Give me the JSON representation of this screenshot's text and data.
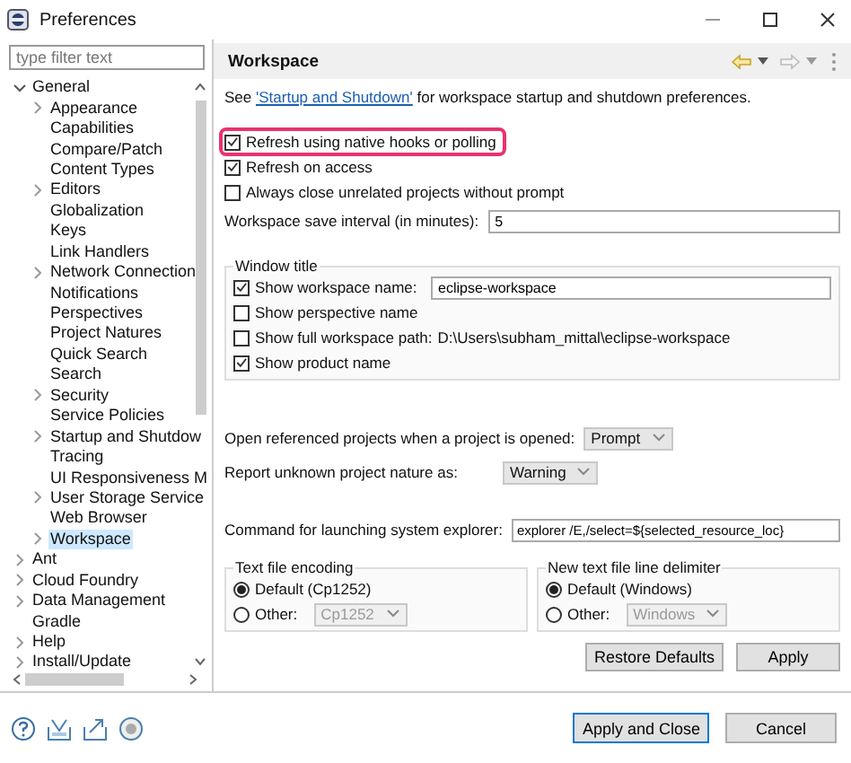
{
  "window": {
    "title": "Preferences"
  },
  "filter": {
    "placeholder": "type filter text"
  },
  "tree": [
    {
      "label": "General",
      "expanded": true,
      "selected": false,
      "children": [
        {
          "label": "Appearance",
          "expanded": false,
          "selected": false
        },
        {
          "label": "Capabilities",
          "selected": false
        },
        {
          "label": "Compare/Patch",
          "selected": false
        },
        {
          "label": "Content Types",
          "selected": false
        },
        {
          "label": "Editors",
          "expanded": false,
          "selected": false
        },
        {
          "label": "Globalization",
          "selected": false
        },
        {
          "label": "Keys",
          "selected": false
        },
        {
          "label": "Link Handlers",
          "selected": false
        },
        {
          "label": "Network Connection",
          "expanded": false,
          "selected": false
        },
        {
          "label": "Notifications",
          "selected": false
        },
        {
          "label": "Perspectives",
          "selected": false
        },
        {
          "label": "Project Natures",
          "selected": false
        },
        {
          "label": "Quick Search",
          "selected": false
        },
        {
          "label": "Search",
          "selected": false
        },
        {
          "label": "Security",
          "expanded": false,
          "selected": false
        },
        {
          "label": "Service Policies",
          "selected": false
        },
        {
          "label": "Startup and Shutdow",
          "expanded": false,
          "selected": false
        },
        {
          "label": "Tracing",
          "selected": false
        },
        {
          "label": "UI Responsiveness M",
          "selected": false
        },
        {
          "label": "User Storage Service",
          "expanded": false,
          "selected": false
        },
        {
          "label": "Web Browser",
          "selected": false
        },
        {
          "label": "Workspace",
          "expanded": false,
          "selected": true
        }
      ]
    },
    {
      "label": "Ant",
      "expanded": false,
      "selected": false
    },
    {
      "label": "Cloud Foundry",
      "expanded": false,
      "selected": false
    },
    {
      "label": "Data Management",
      "expanded": false,
      "selected": false
    },
    {
      "label": "Gradle",
      "selected": false
    },
    {
      "label": "Help",
      "expanded": false,
      "selected": false
    },
    {
      "label": "Install/Update",
      "expanded": false,
      "selected": false
    }
  ],
  "page": {
    "title": "Workspace",
    "intro": {
      "before": "See ",
      "link": "'Startup and Shutdown'",
      "after": " for workspace startup and shutdown preferences."
    },
    "checkboxes": [
      {
        "label": "Refresh using native hooks or polling",
        "checked": true,
        "highlighted": true
      },
      {
        "label": "Refresh on access",
        "checked": true,
        "highlighted": false
      },
      {
        "label": "Always close unrelated projects without prompt",
        "checked": false,
        "highlighted": false
      }
    ],
    "save_interval": {
      "label": "Workspace save interval (in minutes):",
      "value": "5"
    },
    "window_title": {
      "title": "Window title",
      "rows": [
        {
          "kind": "field",
          "label": "Show workspace name:",
          "checked": true,
          "value": "eclipse-workspace"
        },
        {
          "kind": "plain",
          "label": "Show perspective name",
          "checked": false
        },
        {
          "kind": "info",
          "label": "Show full workspace path:",
          "checked": false,
          "value": "D:\\Users\\subham_mittal\\eclipse-workspace"
        },
        {
          "kind": "plain",
          "label": "Show product name",
          "checked": true
        }
      ]
    },
    "selects": [
      {
        "label": "Open referenced projects when a project is opened:",
        "value": "Prompt"
      },
      {
        "label": "Report unknown project nature as:",
        "value": "Warning"
      }
    ],
    "explorer": {
      "label": "Command for launching system explorer:",
      "value": "explorer /E,/select=${selected_resource_loc}"
    },
    "groups": [
      {
        "title": "Text file encoding",
        "options": [
          {
            "label": "Default (Cp1252)",
            "selected": true
          },
          {
            "label": "Other:",
            "selected": false
          }
        ],
        "other_value": "Cp1252"
      },
      {
        "title": "New text file line delimiter",
        "options": [
          {
            "label": "Default (Windows)",
            "selected": true
          },
          {
            "label": "Other:",
            "selected": false
          }
        ],
        "other_value": "Windows"
      }
    ],
    "buttons": [
      "Restore Defaults",
      "Apply"
    ]
  },
  "footer": {
    "buttons": [
      "Apply and Close",
      "Cancel"
    ]
  }
}
